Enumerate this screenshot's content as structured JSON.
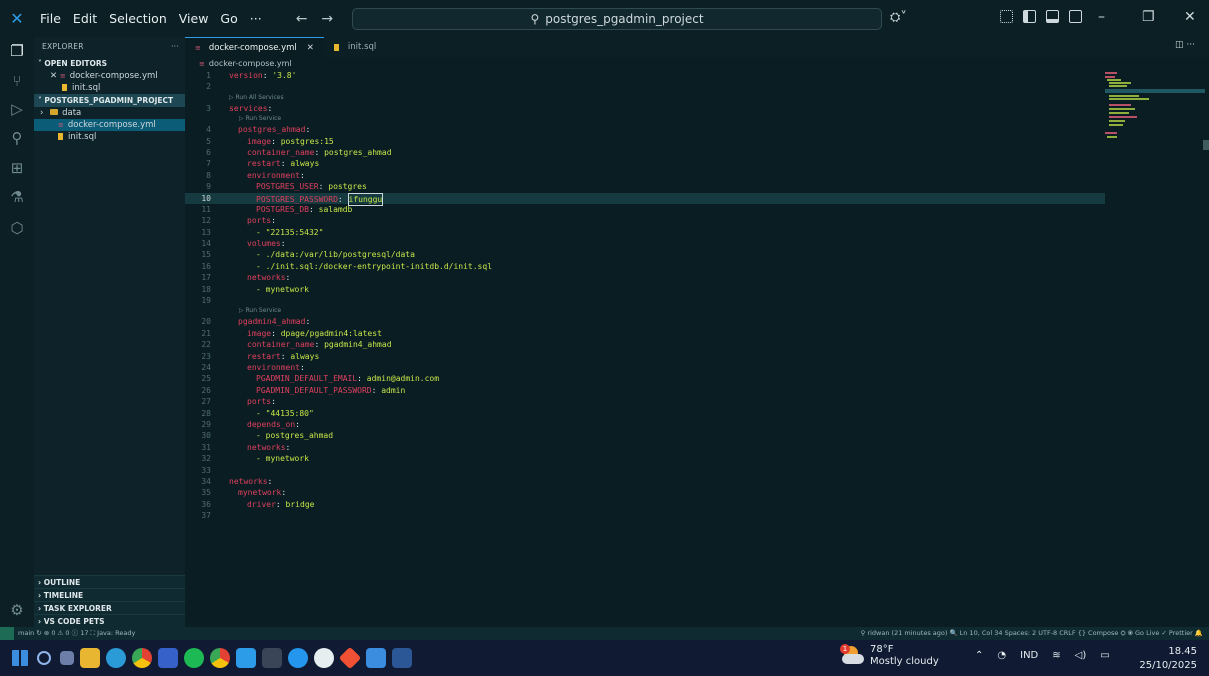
{
  "titlebar": {
    "menus": [
      "File",
      "Edit",
      "Selection",
      "View",
      "Go",
      "···"
    ],
    "search": "postgres_pgadmin_project"
  },
  "sidebar": {
    "explorer_label": "EXPLORER",
    "more": "···",
    "open_editors_label": "OPEN EDITORS",
    "open_editors": [
      "docker-compose.yml",
      "init.sql"
    ],
    "project_label": "POSTGRES_PGADMIN_PROJECT",
    "tree": [
      "data",
      "docker-compose.yml",
      "init.sql"
    ],
    "bottom_sections": [
      "OUTLINE",
      "TIMELINE",
      "TASK EXPLORER",
      "VS CODE PETS"
    ]
  },
  "tabs": [
    {
      "label": "docker-compose.yml",
      "active": true
    },
    {
      "label": "init.sql",
      "active": false
    }
  ],
  "breadcrumb": "docker-compose.yml",
  "codelens": {
    "run_all": "▷ Run All Services",
    "run_service": "▷ Run Service"
  },
  "code": {
    "l1_k": "version",
    "l1_v": "'3.8'",
    "l3_k": "services",
    "l4_k": "postgres_ahmad",
    "l5_k": "image",
    "l5_v": "postgres:15",
    "l6_k": "container_name",
    "l6_v": "postgres_ahmad",
    "l7_k": "restart",
    "l7_v": "always",
    "l8_k": "environment",
    "l9_k": "POSTGRES_USER",
    "l9_v": "postgres",
    "l10_k": "POSTGRES_PASSWORD",
    "l10_v": "ifunggu",
    "l11_k": "POSTGRES_DB",
    "l11_v": "salamdb",
    "l12_k": "ports",
    "l13_v": "- \"22135:5432\"",
    "l14_k": "volumes",
    "l15_v": "- ./data:/var/lib/postgresql/data",
    "l16_v": "- ./init.sql:/docker-entrypoint-initdb.d/init.sql",
    "l17_k": "networks",
    "l18_v": "- mynetwork",
    "l20_k": "pgadmin4_ahmad",
    "l21_k": "image",
    "l21_v": "dpage/pgadmin4:latest",
    "l22_k": "container_name",
    "l22_v": "pgadmin4_ahmad",
    "l23_k": "restart",
    "l23_v": "always",
    "l24_k": "environment",
    "l25_k": "PGADMIN_DEFAULT_EMAIL",
    "l25_v": "admin@admin.com",
    "l26_k": "PGADMIN_DEFAULT_PASSWORD",
    "l26_v": "admin",
    "l27_k": "ports",
    "l28_v": "- \"44135:80\"",
    "l29_k": "depends_on",
    "l30_v": "- postgres_ahmad",
    "l31_k": "networks",
    "l32_v": "- mynetwork",
    "l34_k": "networks",
    "l35_k": "mynetwork",
    "l36_k": "driver",
    "l36_v": "bridge"
  },
  "status": {
    "left": "main ↻   ⊗ 0 ⚠ 0 ⓘ 17   ⛶ Java: Ready",
    "right": "⚲ ridwan (21 minutes ago)   🔍   Ln 10, Col 34   Spaces: 2   UTF-8   CRLF   {} Compose   ⛭   ⦿ Go Live   ✓ Prettier   🔔"
  },
  "taskbar": {
    "weather_temp": "78°F",
    "weather_desc": "Mostly cloudy",
    "weather_badge": "1",
    "lang": "IND",
    "time": "18.45",
    "date": "25/10/2025"
  },
  "colors": {
    "keyword": "#e0405e",
    "string": "#c8e64a",
    "background": "#0a1d22",
    "accent": "#2c9be8"
  }
}
